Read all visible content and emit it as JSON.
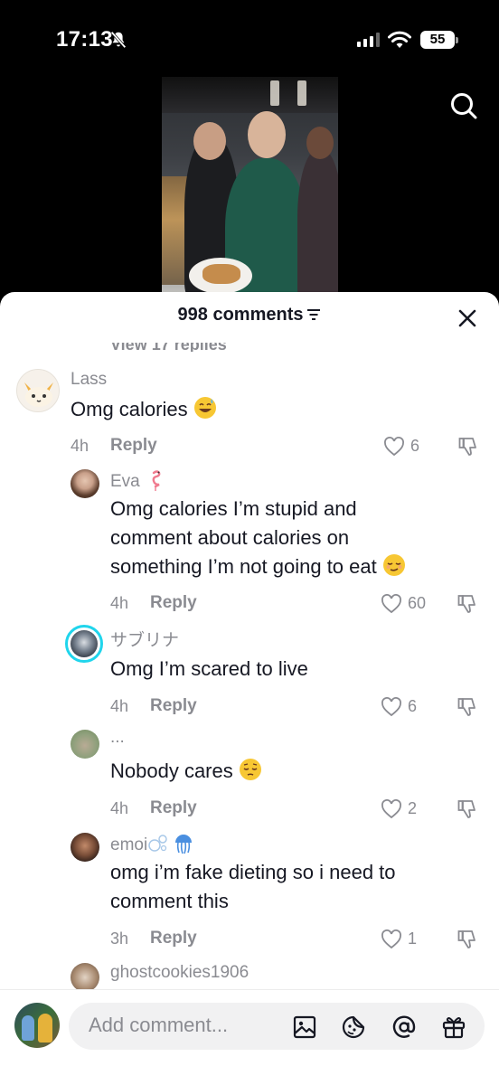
{
  "status_bar": {
    "time": "17:13",
    "battery": "55"
  },
  "sheet": {
    "comments_count": "998 comments",
    "hidden_replies": "View 17 replies"
  },
  "comments": [
    {
      "username": "Lass",
      "text": "Omg calories",
      "time": "4h",
      "reply": "Reply",
      "likes": "6"
    },
    {
      "username": "Eva",
      "text_lines": [
        "Omg calories I’m stupid and",
        "comment about calories on",
        "something I’m not going to eat"
      ],
      "time": "4h",
      "reply": "Reply",
      "likes": "60"
    },
    {
      "username": "サブリナ",
      "text": "Omg I’m scared to live",
      "time": "4h",
      "reply": "Reply",
      "likes": "6"
    },
    {
      "username": "...",
      "text": "Nobody cares",
      "time": "4h",
      "reply": "Reply",
      "likes": "2"
    },
    {
      "username": "emoi",
      "text_lines": [
        "omg i’m fake dieting so i need to",
        "comment this"
      ],
      "time": "3h",
      "reply": "Reply",
      "likes": "1"
    },
    {
      "username": "ghostcookies1906"
    }
  ],
  "input": {
    "placeholder": "Add comment..."
  },
  "icons": {
    "status": [
      "bell-slash-icon",
      "signal-icon",
      "wifi-icon",
      "battery-icon"
    ],
    "top": [
      "search-icon"
    ],
    "header": [
      "sort-icon",
      "close-icon"
    ],
    "comment_actions": [
      "heart-icon",
      "thumbs-down-icon"
    ],
    "input": [
      "image-icon",
      "sticker-icon",
      "mention-icon",
      "gift-icon"
    ]
  },
  "colors": {
    "text": "#161823",
    "muted": "#8a8b91",
    "sheet_bg": "#ffffff",
    "input_bg": "#f1f1f2",
    "story_ring": "#20d5ec"
  }
}
